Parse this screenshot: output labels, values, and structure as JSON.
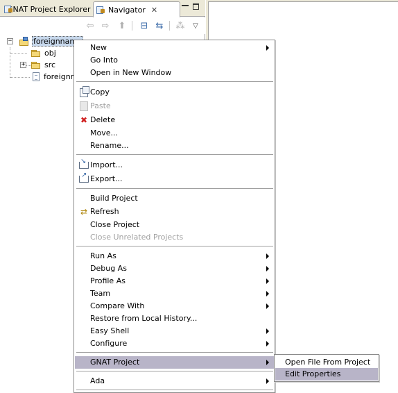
{
  "tabs": [
    {
      "label": "GNAT Project Explorer",
      "active": false
    },
    {
      "label": "Navigator",
      "active": true,
      "close": "✕"
    }
  ],
  "tree": [
    {
      "label": "foreignname",
      "icon": "project-icon",
      "toggle": "−",
      "selected": true
    },
    {
      "label": "obj",
      "icon": "folder-icon"
    },
    {
      "label": "src",
      "icon": "folder-icon",
      "toggle": "+"
    },
    {
      "label": "foreignn",
      "icon": "file-icon"
    }
  ],
  "menu": {
    "items": [
      {
        "label": "New",
        "submenu": true
      },
      {
        "label": "Go Into"
      },
      {
        "label": "Open in New Window"
      },
      {
        "label": "Copy",
        "icon": "copy-icon"
      },
      {
        "label": "Paste",
        "icon": "paste-icon",
        "disabled": true
      },
      {
        "label": "Delete",
        "icon": "delete-icon"
      },
      {
        "label": "Move..."
      },
      {
        "label": "Rename..."
      },
      {
        "label": "Import...",
        "icon": "import-icon"
      },
      {
        "label": "Export...",
        "icon": "export-icon"
      },
      {
        "label": "Build Project"
      },
      {
        "label": "Refresh",
        "icon": "refresh-icon"
      },
      {
        "label": "Close Project"
      },
      {
        "label": "Close Unrelated Projects",
        "disabled": true
      },
      {
        "label": "Run As",
        "submenu": true
      },
      {
        "label": "Debug As",
        "submenu": true
      },
      {
        "label": "Profile As",
        "submenu": true
      },
      {
        "label": "Team",
        "submenu": true
      },
      {
        "label": "Compare With",
        "submenu": true
      },
      {
        "label": "Restore from Local History..."
      },
      {
        "label": "Easy Shell",
        "submenu": true
      },
      {
        "label": "Configure",
        "submenu": true
      },
      {
        "label": "GNAT Project",
        "submenu": true,
        "highlighted": true
      },
      {
        "label": "Ada",
        "submenu": true
      }
    ]
  },
  "submenu": {
    "items": [
      {
        "label": "Open File From Project"
      },
      {
        "label": "Edit Properties",
        "highlighted": true
      }
    ]
  },
  "colors": {
    "chrome": "#ece9d8",
    "highlight": "#b8b4c8",
    "tree_selection": "#c7d8ec",
    "disabled_text": "#a0a0a0",
    "delete_red": "#d02020"
  }
}
